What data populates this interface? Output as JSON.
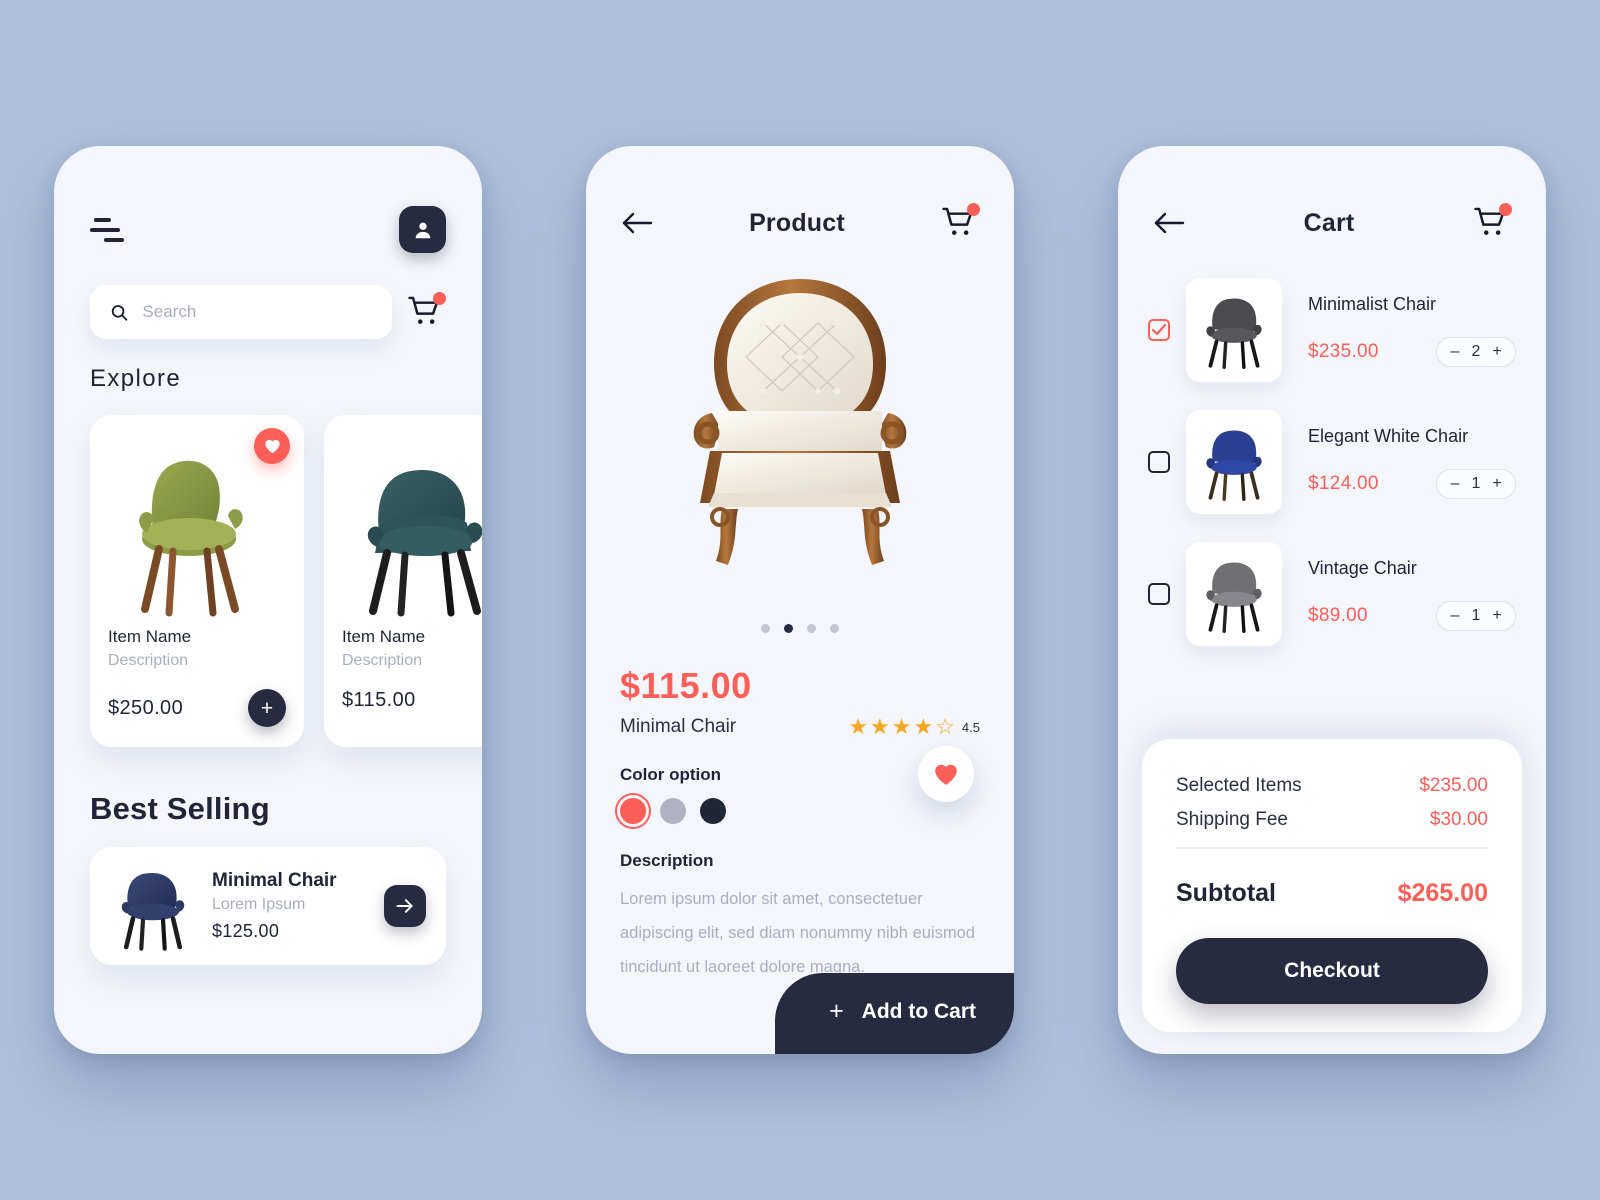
{
  "theme": {
    "background": "#aec0dc",
    "screen_bg": "#f4f6fb",
    "accent_coral": "#fb5f58",
    "dark_navy": "#262b41",
    "muted_text": "#a9adc2",
    "star_gold": "#f5a623"
  },
  "home": {
    "menu_icon": "hamburger-menu-icon",
    "profile_icon": "user-avatar-icon",
    "search": {
      "icon": "search-icon",
      "value": "",
      "placeholder": "Search"
    },
    "cart_icon": "shopping-cart-icon",
    "cart_badge": "",
    "explore_title": "Explore",
    "explore_items": [
      {
        "name": "Item Name",
        "description": "Description",
        "price": "$250.00",
        "favorited": true,
        "add_label": "+",
        "chair_color": "olive-green"
      },
      {
        "name": "Item Name",
        "description": "Description",
        "price": "$115.00",
        "favorited": false,
        "chair_color": "teal"
      }
    ],
    "best_title": "Best Selling",
    "best_item": {
      "name": "Minimal Chair",
      "subtitle": "Lorem Ipsum",
      "price": "$125.00",
      "go_icon": "arrow-right-icon",
      "chair_color": "navy-blue"
    }
  },
  "product": {
    "back_icon": "arrow-left-icon",
    "title": "Product",
    "cart_icon": "shopping-cart-icon",
    "image_alt": "victorian-armchair",
    "carousel": {
      "count": 4,
      "active_index": 1
    },
    "favorite_icon": "heart-icon",
    "price": "$115.00",
    "name": "Minimal Chair",
    "rating": {
      "stars_filled": 4,
      "stars_total": 5,
      "value": "4.5"
    },
    "color_option_label": "Color option",
    "colors": [
      {
        "name": "coral",
        "hex": "#fb5f58",
        "selected": true
      },
      {
        "name": "grey",
        "hex": "#b0b2c4",
        "selected": false
      },
      {
        "name": "dark-navy",
        "hex": "#212636",
        "selected": false
      }
    ],
    "description_label": "Description",
    "description_text": "Lorem ipsum dolor sit amet, consectetuer adipiscing elit, sed diam nonummy nibh euismod tincidunt ut laoreet dolore magna.",
    "add_to_cart_label": "Add to Cart",
    "add_to_cart_icon": "plus-icon"
  },
  "cart": {
    "back_icon": "arrow-left-icon",
    "title": "Cart",
    "cart_icon": "shopping-cart-icon",
    "items": [
      {
        "name": "Minimalist Chair",
        "price": "$235.00",
        "quantity": "2",
        "selected": true,
        "decrement": "–",
        "increment": "+",
        "chair_color": "dark-grey"
      },
      {
        "name": "Elegant White Chair",
        "price": "$124.00",
        "quantity": "1",
        "selected": false,
        "decrement": "–",
        "increment": "+",
        "chair_color": "royal-blue"
      },
      {
        "name": "Vintage Chair",
        "price": "$89.00",
        "quantity": "1",
        "selected": false,
        "decrement": "–",
        "increment": "+",
        "chair_color": "grey"
      }
    ],
    "summary": {
      "selected_items_label": "Selected Items",
      "selected_items_value": "$235.00",
      "shipping_label": "Shipping Fee",
      "shipping_value": "$30.00",
      "subtotal_label": "Subtotal",
      "subtotal_value": "$265.00",
      "checkout_label": "Checkout"
    }
  }
}
